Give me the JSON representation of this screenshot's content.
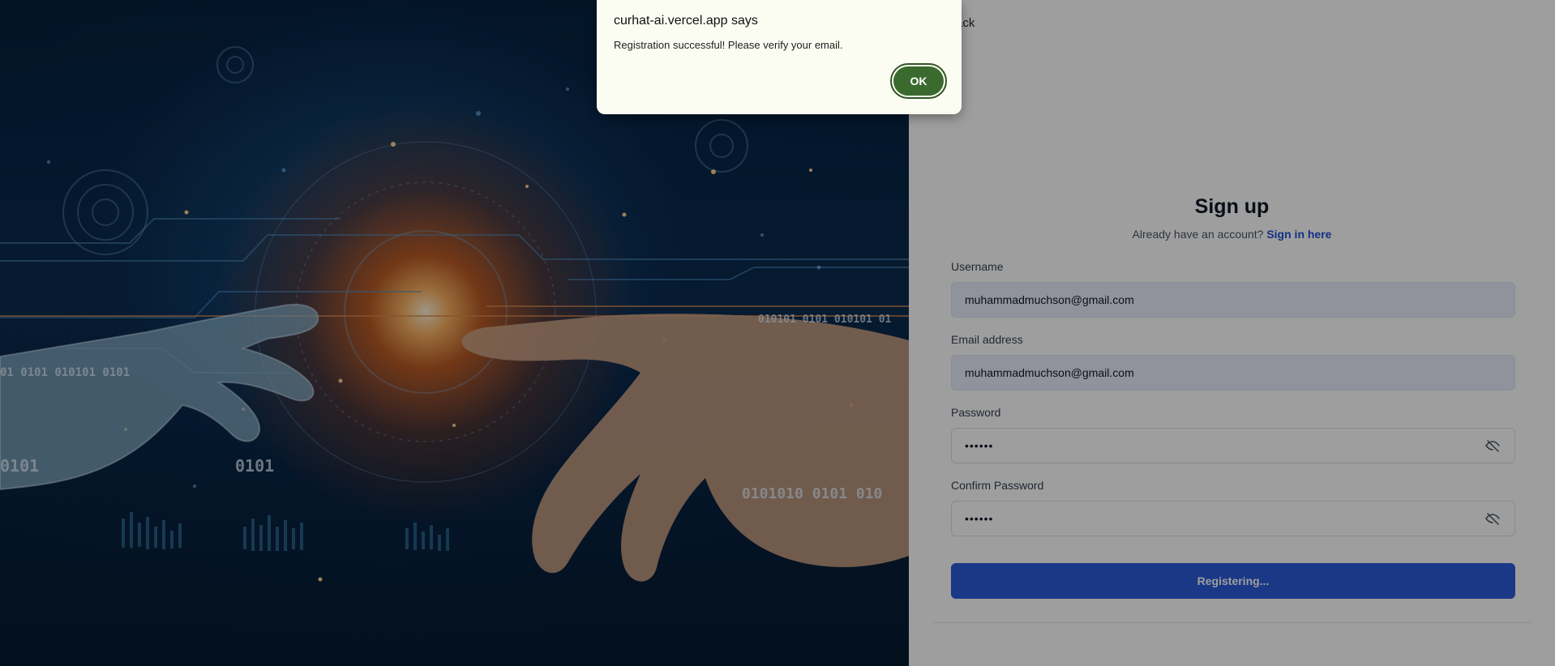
{
  "back_link": {
    "label": "Back"
  },
  "signup": {
    "title": "Sign up",
    "subtitle_text": "Already have an account?",
    "signin_link": "Sign in here",
    "username": {
      "label": "Username",
      "value": "muhammadmuchson@gmail.com"
    },
    "email": {
      "label": "Email address",
      "value": "muhammadmuchson@gmail.com"
    },
    "password": {
      "label": "Password",
      "value": "••••••"
    },
    "confirm_password": {
      "label": "Confirm Password",
      "value": "••••••"
    },
    "submit_label": "Registering...",
    "icons": {
      "password_toggle": "eye-off-icon",
      "confirm_toggle": "eye-off-icon"
    }
  },
  "hero": {
    "overlay_texts": [
      "0101",
      "0101",
      "01 0101 010101 0101",
      "0101010 0101 010",
      "010101 0101 010101 01"
    ]
  },
  "dialog": {
    "title": "curhat-ai.vercel.app says",
    "message": "Registration successful! Please verify your email.",
    "ok_label": "OK"
  },
  "colors": {
    "primary_button": "#2b5bd8",
    "link": "#1d4ed8",
    "dialog_ok": "#3b6a2f",
    "dialog_bg": "#fbfdf3"
  }
}
